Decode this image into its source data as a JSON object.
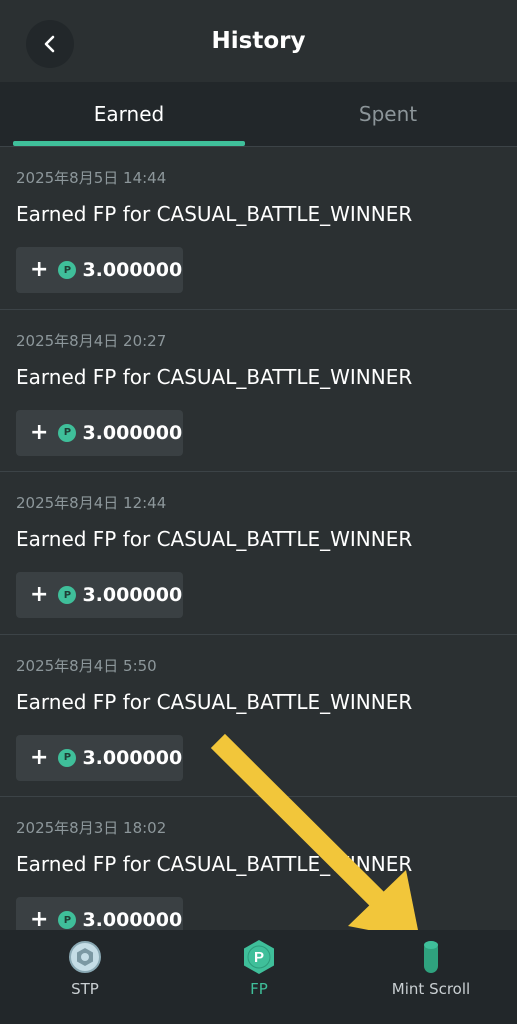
{
  "header": {
    "title": "History",
    "back_icon": "chevron-left-icon"
  },
  "tabs": [
    {
      "label": "Earned",
      "active": true
    },
    {
      "label": "Spent",
      "active": false
    }
  ],
  "items": [
    {
      "date": "2025年8月5日 14:44",
      "description": "Earned FP for CASUAL_BATTLE_WINNER",
      "sign": "+",
      "coin": "P",
      "amount": "3.000000"
    },
    {
      "date": "2025年8月4日 20:27",
      "description": "Earned FP for CASUAL_BATTLE_WINNER",
      "sign": "+",
      "coin": "P",
      "amount": "3.000000"
    },
    {
      "date": "2025年8月4日 12:44",
      "description": "Earned FP for CASUAL_BATTLE_WINNER",
      "sign": "+",
      "coin": "P",
      "amount": "3.000000"
    },
    {
      "date": "2025年8月4日 5:50",
      "description": "Earned FP for CASUAL_BATTLE_WINNER",
      "sign": "+",
      "coin": "P",
      "amount": "3.000000"
    },
    {
      "date": "2025年8月3日 18:02",
      "description": "Earned FP for CASUAL_BATTLE_WINNER",
      "sign": "+",
      "coin": "P",
      "amount": "3.000000"
    }
  ],
  "bottom_nav": {
    "stp": {
      "label": "STP",
      "icon": "stp-coin-icon"
    },
    "fp": {
      "label": "FP",
      "icon": "fp-hexagon-icon",
      "fp_glyph": "P",
      "active": true
    },
    "mint": {
      "label": "Mint Scroll",
      "icon": "scroll-icon"
    }
  },
  "colors": {
    "background": "#2b3032",
    "accent": "#3fbf9a",
    "annotation_arrow": "#f2c63a"
  }
}
